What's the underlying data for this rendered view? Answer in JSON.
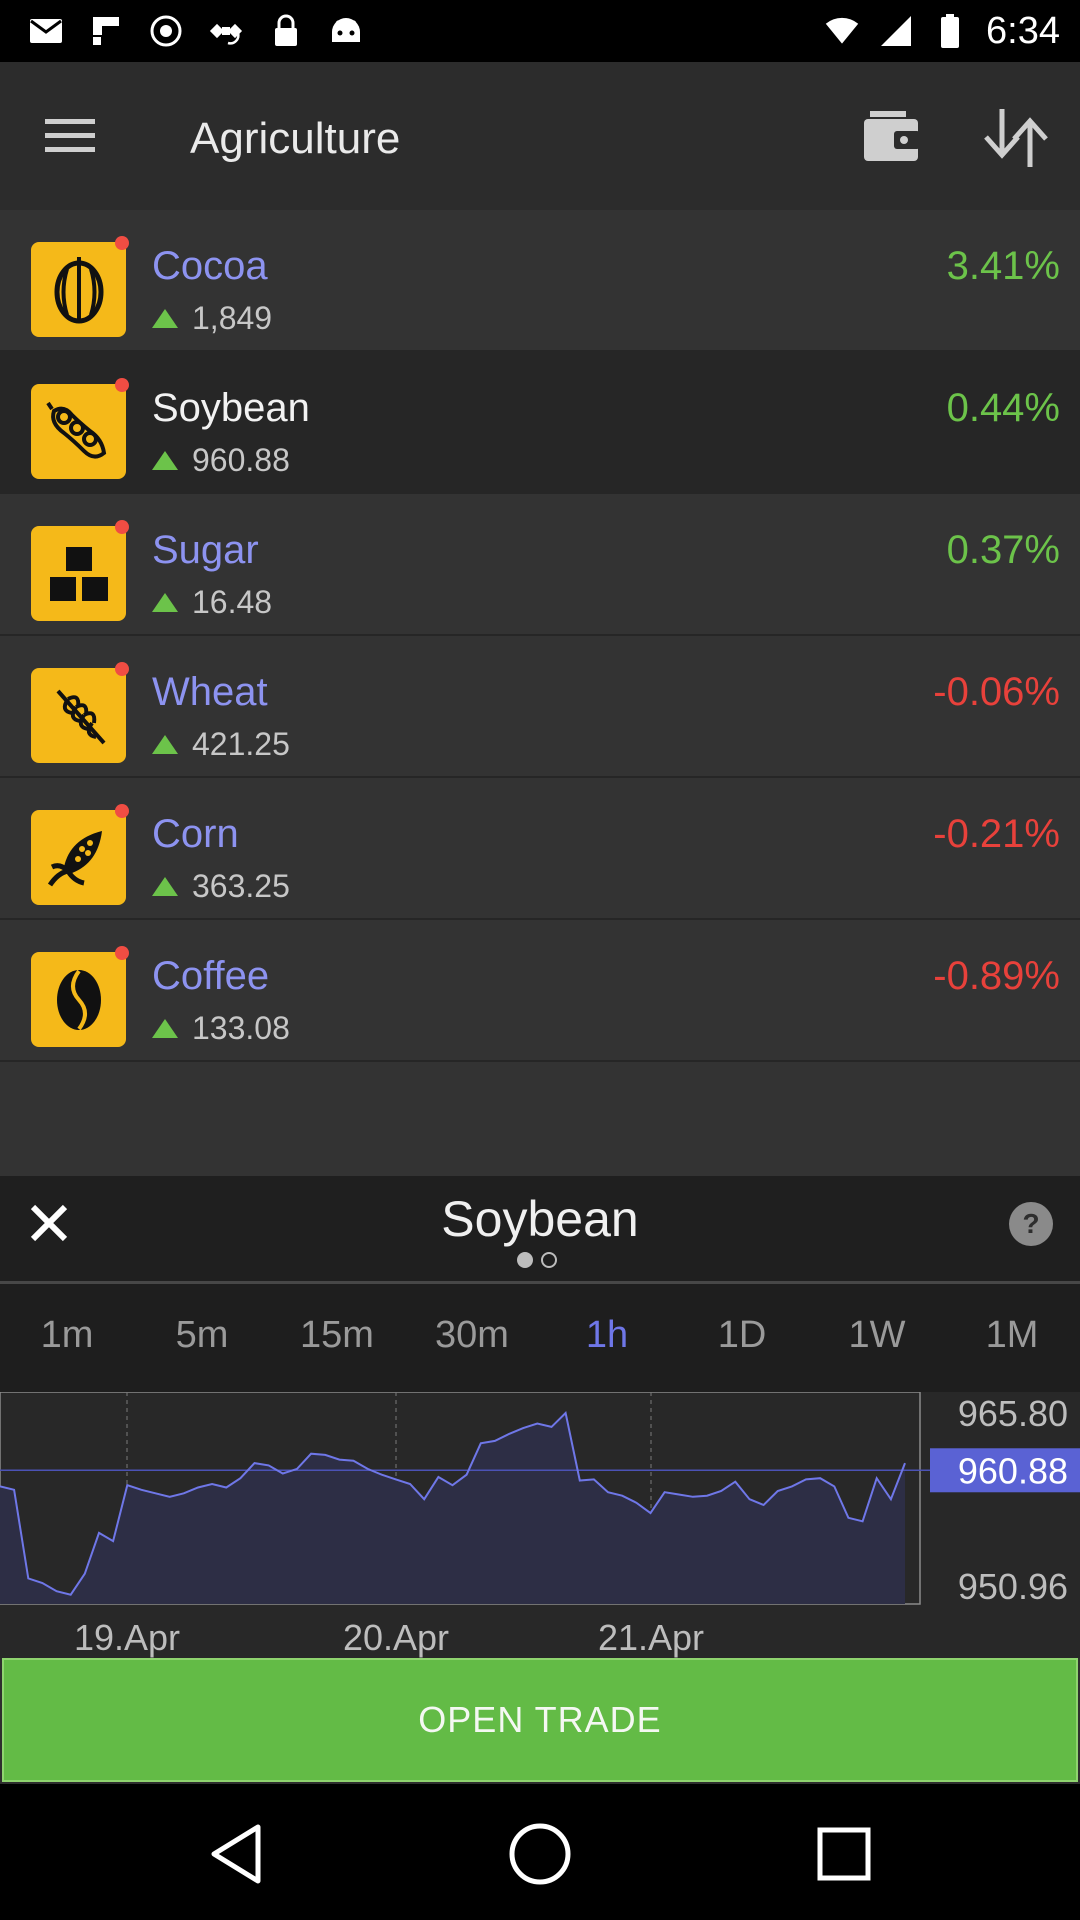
{
  "status_bar": {
    "time": "6:34",
    "icons": [
      "mail-icon",
      "flipboard-icon",
      "sync-icon",
      "satellite-icon",
      "lock-icon",
      "android-icon",
      "wifi-icon",
      "signal-icon",
      "battery-icon"
    ]
  },
  "app_bar": {
    "title": "Agriculture",
    "menu_icon": "hamburger-menu-icon",
    "wallet_icon": "wallet-icon",
    "sort_icon": "sort-arrows-icon"
  },
  "instruments": [
    {
      "name": "Cocoa",
      "price": "1,849",
      "change": "3.41%",
      "direction": "up",
      "icon": "cocoa-pod-icon",
      "selected": false
    },
    {
      "name": "Soybean",
      "price": "960.88",
      "change": "0.44%",
      "direction": "up",
      "icon": "soybean-pod-icon",
      "selected": true
    },
    {
      "name": "Sugar",
      "price": "16.48",
      "change": "0.37%",
      "direction": "up",
      "icon": "sugar-cubes-icon",
      "selected": false
    },
    {
      "name": "Wheat",
      "price": "421.25",
      "change": "-0.06%",
      "direction": "down",
      "icon": "wheat-icon",
      "selected": false
    },
    {
      "name": "Corn",
      "price": "363.25",
      "change": "-0.21%",
      "direction": "down",
      "icon": "corn-icon",
      "selected": false
    },
    {
      "name": "Coffee",
      "price": "133.08",
      "change": "-0.89%",
      "direction": "down",
      "icon": "coffee-bean-icon",
      "selected": false
    }
  ],
  "panel": {
    "title": "Soybean",
    "close_icon": "close-icon",
    "help_label": "?",
    "pager": {
      "count": 2,
      "active": 0
    },
    "timeframes": [
      "1m",
      "5m",
      "15m",
      "30m",
      "1h",
      "1D",
      "1W",
      "1M"
    ],
    "active_timeframe": "1h",
    "open_trade_label": "OPEN TRADE"
  },
  "chart_data": {
    "type": "area",
    "title": "",
    "xlabel": "",
    "ylabel": "",
    "x_ticks": [
      "19.Apr",
      "20.Apr",
      "21.Apr"
    ],
    "y_labels": [
      "965.80",
      "960.88",
      "950.96"
    ],
    "current_value": 960.88,
    "ylim": [
      949.4,
      967.6
    ],
    "grid": true,
    "series": [
      {
        "values": [
          959.5,
          959.2,
          951.6,
          951.2,
          950.5,
          950.2,
          952.0,
          955.5,
          954.8,
          959.6,
          959.2,
          958.9,
          958.6,
          958.9,
          959.4,
          959.7,
          959.4,
          960.2,
          961.5,
          961.3,
          960.6,
          961.0,
          962.3,
          962.2,
          961.8,
          961.7,
          961.0,
          960.5,
          960.1,
          959.7,
          958.4,
          960.3,
          959.6,
          960.5,
          963.2,
          963.4,
          964.0,
          964.5,
          964.9,
          964.6,
          965.8,
          960.0,
          960.1,
          959.0,
          958.7,
          958.1,
          957.2,
          959.0,
          958.8,
          958.6,
          958.7,
          959.1,
          959.9,
          958.4,
          957.9,
          959.1,
          959.5,
          960.1,
          960.2,
          959.5,
          956.8,
          956.5,
          960.2,
          958.4,
          961.5
        ]
      }
    ]
  }
}
